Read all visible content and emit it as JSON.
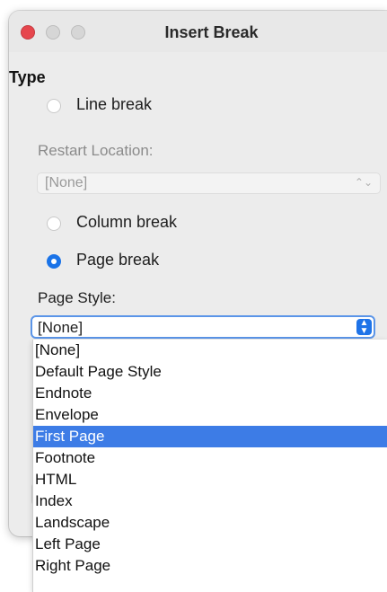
{
  "window": {
    "title": "Insert Break"
  },
  "type_section": {
    "heading": "Type",
    "options": [
      {
        "label": "Line break",
        "checked": false
      },
      {
        "label": "Column break",
        "checked": false
      },
      {
        "label": "Page break",
        "checked": true
      }
    ]
  },
  "restart_location": {
    "label": "Restart Location:",
    "value": "[None]",
    "disabled": true
  },
  "page_style": {
    "label": "Page Style:",
    "value": "[None]",
    "options": [
      "[None]",
      "Default Page Style",
      "Endnote",
      "Envelope",
      "First Page",
      "Footnote",
      "HTML",
      "Index",
      "Landscape",
      "Left Page",
      "Right Page"
    ],
    "highlighted_option": "First Page"
  },
  "colors": {
    "accent": "#1a73e8",
    "highlight": "#3d7ce6",
    "close_button": "#e6464d"
  }
}
